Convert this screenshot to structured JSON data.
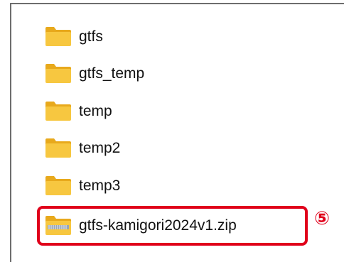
{
  "explorer": {
    "items": [
      {
        "name": "gtfs",
        "type": "folder",
        "icon": "folder-icon"
      },
      {
        "name": "gtfs_temp",
        "type": "folder",
        "icon": "folder-icon"
      },
      {
        "name": "temp",
        "type": "folder",
        "icon": "folder-icon"
      },
      {
        "name": "temp2",
        "type": "folder",
        "icon": "folder-icon"
      },
      {
        "name": "temp3",
        "type": "folder",
        "icon": "folder-icon"
      },
      {
        "name": "gtfs-kamigori2024v1.zip",
        "type": "zip",
        "icon": "zip-folder-icon"
      }
    ]
  },
  "annotation": {
    "step_marker": "⑤",
    "highlight_color": "#e0001b"
  },
  "colors": {
    "folder_body": "#f7c740",
    "folder_tab": "#e8a91c",
    "zip_stripe": "#9aa6b4"
  }
}
